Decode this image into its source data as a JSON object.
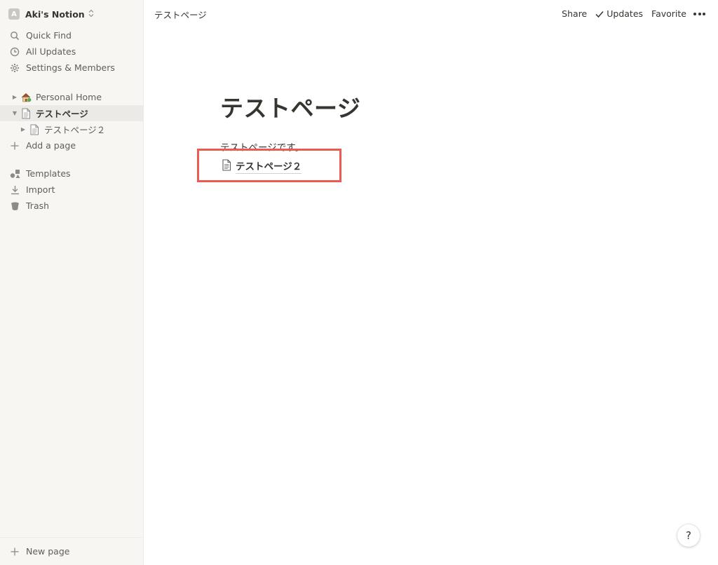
{
  "sidebar": {
    "workspace": {
      "avatar_letter": "A",
      "name": "Aki's Notion"
    },
    "nav": [
      {
        "label": "Quick Find",
        "icon": "search-icon"
      },
      {
        "label": "All Updates",
        "icon": "clock-icon"
      },
      {
        "label": "Settings & Members",
        "icon": "gear-icon"
      }
    ],
    "pages": [
      {
        "label": "Personal Home",
        "icon": "house-emoji-icon",
        "caret": "▶"
      },
      {
        "label": "テストページ",
        "icon": "page-icon",
        "caret": "▼",
        "selected": true
      },
      {
        "label": "テストページ２",
        "icon": "page-icon",
        "caret": "▶",
        "indent": 1
      }
    ],
    "add_page_label": "Add a page",
    "tools": [
      {
        "label": "Templates",
        "icon": "shapes-icon"
      },
      {
        "label": "Import",
        "icon": "download-icon"
      },
      {
        "label": "Trash",
        "icon": "trash-icon"
      }
    ],
    "new_page_label": "New page"
  },
  "topbar": {
    "breadcrumb": "テストページ",
    "share_label": "Share",
    "updates_label": "Updates",
    "favorite_label": "Favorite"
  },
  "page": {
    "title": "テストページ",
    "text": "テストページです。",
    "subpage_link": "テストページ２"
  },
  "help_label": "?",
  "colors": {
    "sidebar_bg": "#f7f6f3",
    "selected_bg": "#ebeae7",
    "highlight_border": "#ec5b52",
    "text": "#37352f"
  }
}
